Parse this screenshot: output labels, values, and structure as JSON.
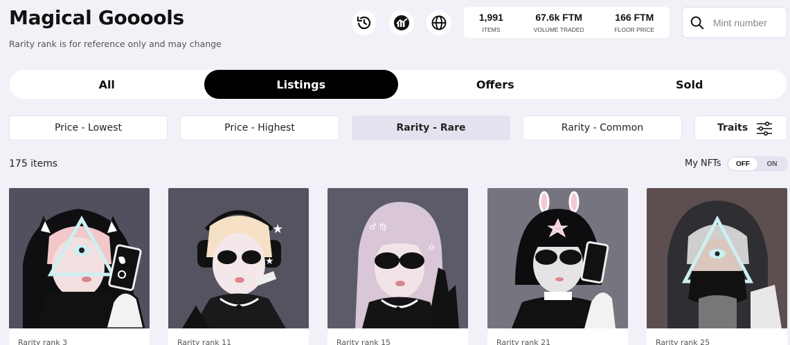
{
  "header": {
    "title": "Magical Gooools",
    "subtitle": "Rarity rank is for reference only and may change",
    "icons": [
      "history-icon",
      "chart-icon",
      "globe-icon"
    ]
  },
  "stats": [
    {
      "value": "1,991",
      "label": "ITEMS"
    },
    {
      "value": "67.6k FTM",
      "label": "VOLUME TRADED"
    },
    {
      "value": "166 FTM",
      "label": "FLOOR PRICE"
    }
  ],
  "search": {
    "placeholder": "Mint number",
    "value": ""
  },
  "tabs": [
    {
      "label": "All",
      "active": false
    },
    {
      "label": "Listings",
      "active": true
    },
    {
      "label": "Offers",
      "active": false
    },
    {
      "label": "Sold",
      "active": false
    }
  ],
  "sorts": [
    {
      "label": "Price - Lowest",
      "active": false
    },
    {
      "label": "Price - Highest",
      "active": false
    },
    {
      "label": "Rarity - Rare",
      "active": true
    },
    {
      "label": "Rarity - Common",
      "active": false
    },
    {
      "label": "Traits",
      "active": false
    }
  ],
  "results": {
    "count_label": "175 items",
    "my_nfts_label": "My NFTs",
    "toggle_off": "OFF",
    "toggle_on": "ON",
    "toggle_state": "OFF"
  },
  "cards": [
    {
      "rank_label": "Rarity rank 3",
      "bg": "#52505e"
    },
    {
      "rank_label": "Rarity rank 11",
      "bg": "#55535f"
    },
    {
      "rank_label": "Rarity rank 15",
      "bg": "#5c5b69"
    },
    {
      "rank_label": "Rarity rank 21",
      "bg": "#76757f"
    },
    {
      "rank_label": "Rarity rank 25",
      "bg": "#5d4f4f"
    }
  ],
  "colors": {
    "accent": "#000000",
    "background": "#f1f2f8",
    "card": "#ffffff"
  }
}
